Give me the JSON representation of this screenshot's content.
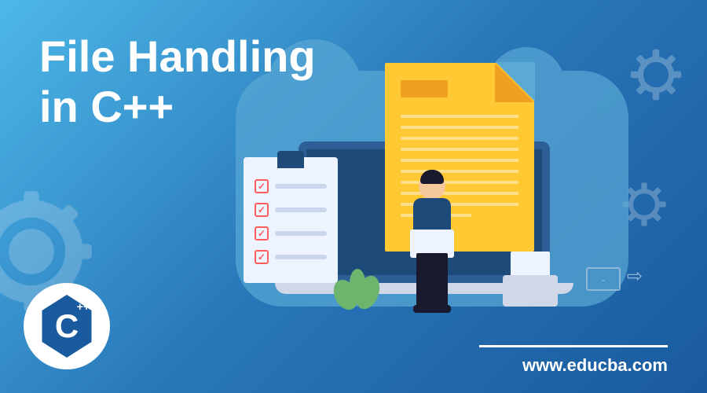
{
  "title_line1": "File Handling",
  "title_line2": "in C++",
  "watermark": "www.educba.com",
  "logo_letter": "C",
  "logo_plus": "++",
  "checklist_checks": [
    "✓",
    "✓",
    "✓",
    "✓"
  ],
  "arrow_glyph": "⇨"
}
